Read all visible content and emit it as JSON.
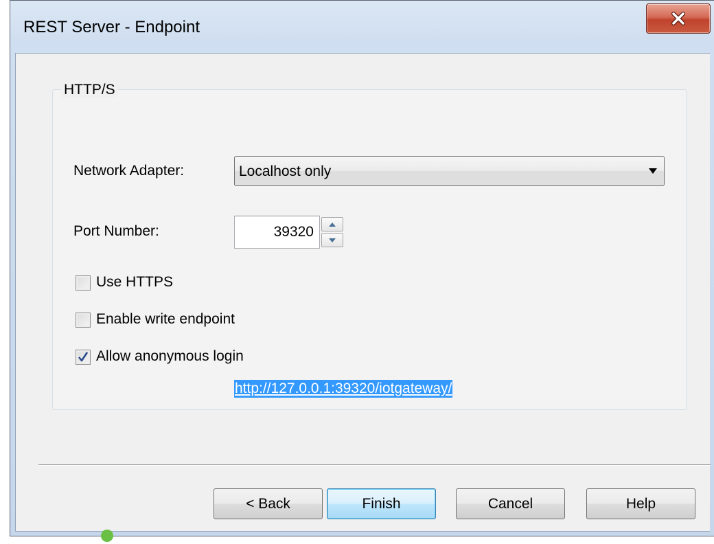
{
  "window": {
    "title": "REST Server - Endpoint",
    "close_icon": "close-icon"
  },
  "group": {
    "legend": "HTTP/S"
  },
  "network_adapter": {
    "label": "Network Adapter:",
    "value": "Localhost only",
    "arrow_icon": "chevron-down-icon"
  },
  "port": {
    "label": "Port Number:",
    "value": "39320"
  },
  "options": {
    "use_https": {
      "label": "Use HTTPS",
      "checked": false
    },
    "enable_write": {
      "label": "Enable write endpoint",
      "checked": false
    },
    "allow_anonymous": {
      "label": "Allow anonymous login",
      "checked": true
    }
  },
  "endpoint_url": "http://127.0.0.1:39320/iotgateway/",
  "buttons": {
    "back": "< Back",
    "finish": "Finish",
    "cancel": "Cancel",
    "help": "Help"
  },
  "colors": {
    "selection": "#3399ff",
    "close_button": "#c9553e",
    "default_button_border": "#3c7fb1"
  }
}
